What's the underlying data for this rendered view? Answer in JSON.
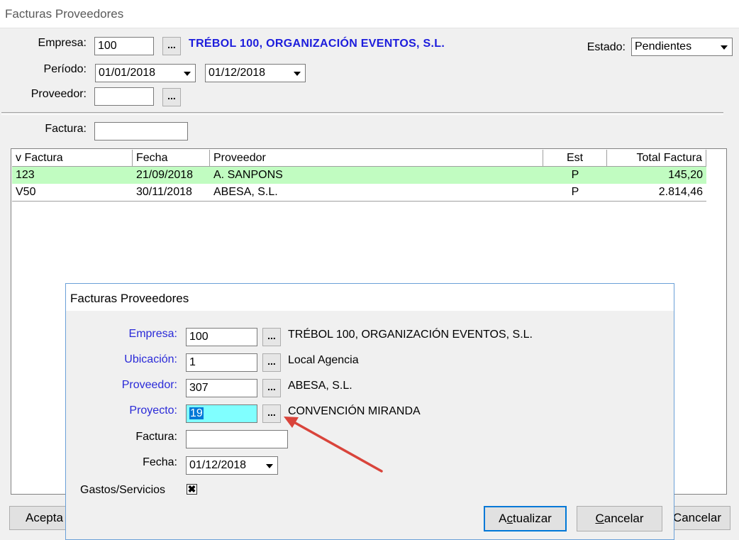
{
  "window": {
    "title": "Facturas Proveedores"
  },
  "filters": {
    "empresa_label": "Empresa:",
    "empresa_value": "100",
    "empresa_btn": "...",
    "empresa_name": "TRÉBOL 100, ORGANIZACIÓN EVENTOS, S.L.",
    "estado_label": "Estado:",
    "estado_value": "Pendientes",
    "periodo_label": "Período:",
    "periodo_from": "01/01/2018",
    "periodo_to": "01/12/2018",
    "proveedor_label": "Proveedor:",
    "proveedor_value": "",
    "proveedor_btn": "...",
    "factura_label": "Factura:",
    "factura_value": ""
  },
  "table": {
    "headers": [
      "v Factura",
      "Fecha",
      "Proveedor",
      "Est",
      "Total Factura"
    ],
    "rows": [
      {
        "factura": "123",
        "fecha": "21/09/2018",
        "proveedor": "A. SANPONS",
        "est": "P",
        "total": "145,20",
        "selected": true
      },
      {
        "factura": "V50",
        "fecha": "30/11/2018",
        "proveedor": "ABESA, S.L.",
        "est": "P",
        "total": "2.814,46",
        "selected": false
      }
    ]
  },
  "bottom": {
    "aceptar_visible": "Acepta",
    "cancelar_visible": "Cancelar"
  },
  "dialog": {
    "title": "Facturas Proveedores",
    "empresa_label": "Empresa:",
    "empresa_value": "100",
    "empresa_name": "TRÉBOL 100, ORGANIZACIÓN EVENTOS, S.L.",
    "ubicacion_label": "Ubicación:",
    "ubicacion_value": "1",
    "ubicacion_name": "Local Agencia",
    "proveedor_label": "Proveedor:",
    "proveedor_value": "307",
    "proveedor_name": "ABESA, S.L.",
    "proyecto_label": "Proyecto:",
    "proyecto_value": "19",
    "proyecto_name": "CONVENCIÓN MIRANDA",
    "factura_label": "Factura:",
    "factura_value": "",
    "fecha_label": "Fecha:",
    "fecha_value": "01/12/2018",
    "gastos_label": "Gastos/Servicios",
    "gastos_checked": "✖",
    "btn_dots": "...",
    "actualizar_pre": "A",
    "actualizar_u": "c",
    "actualizar_post": "tualizar",
    "cancelar_u": "C",
    "cancelar_post": "ancelar"
  },
  "colors": {
    "link_blue": "#2a2ad8",
    "selected_row": "#c1fcc1",
    "proyecto_bg": "#80ffff",
    "arrow_red": "#d9443b"
  }
}
